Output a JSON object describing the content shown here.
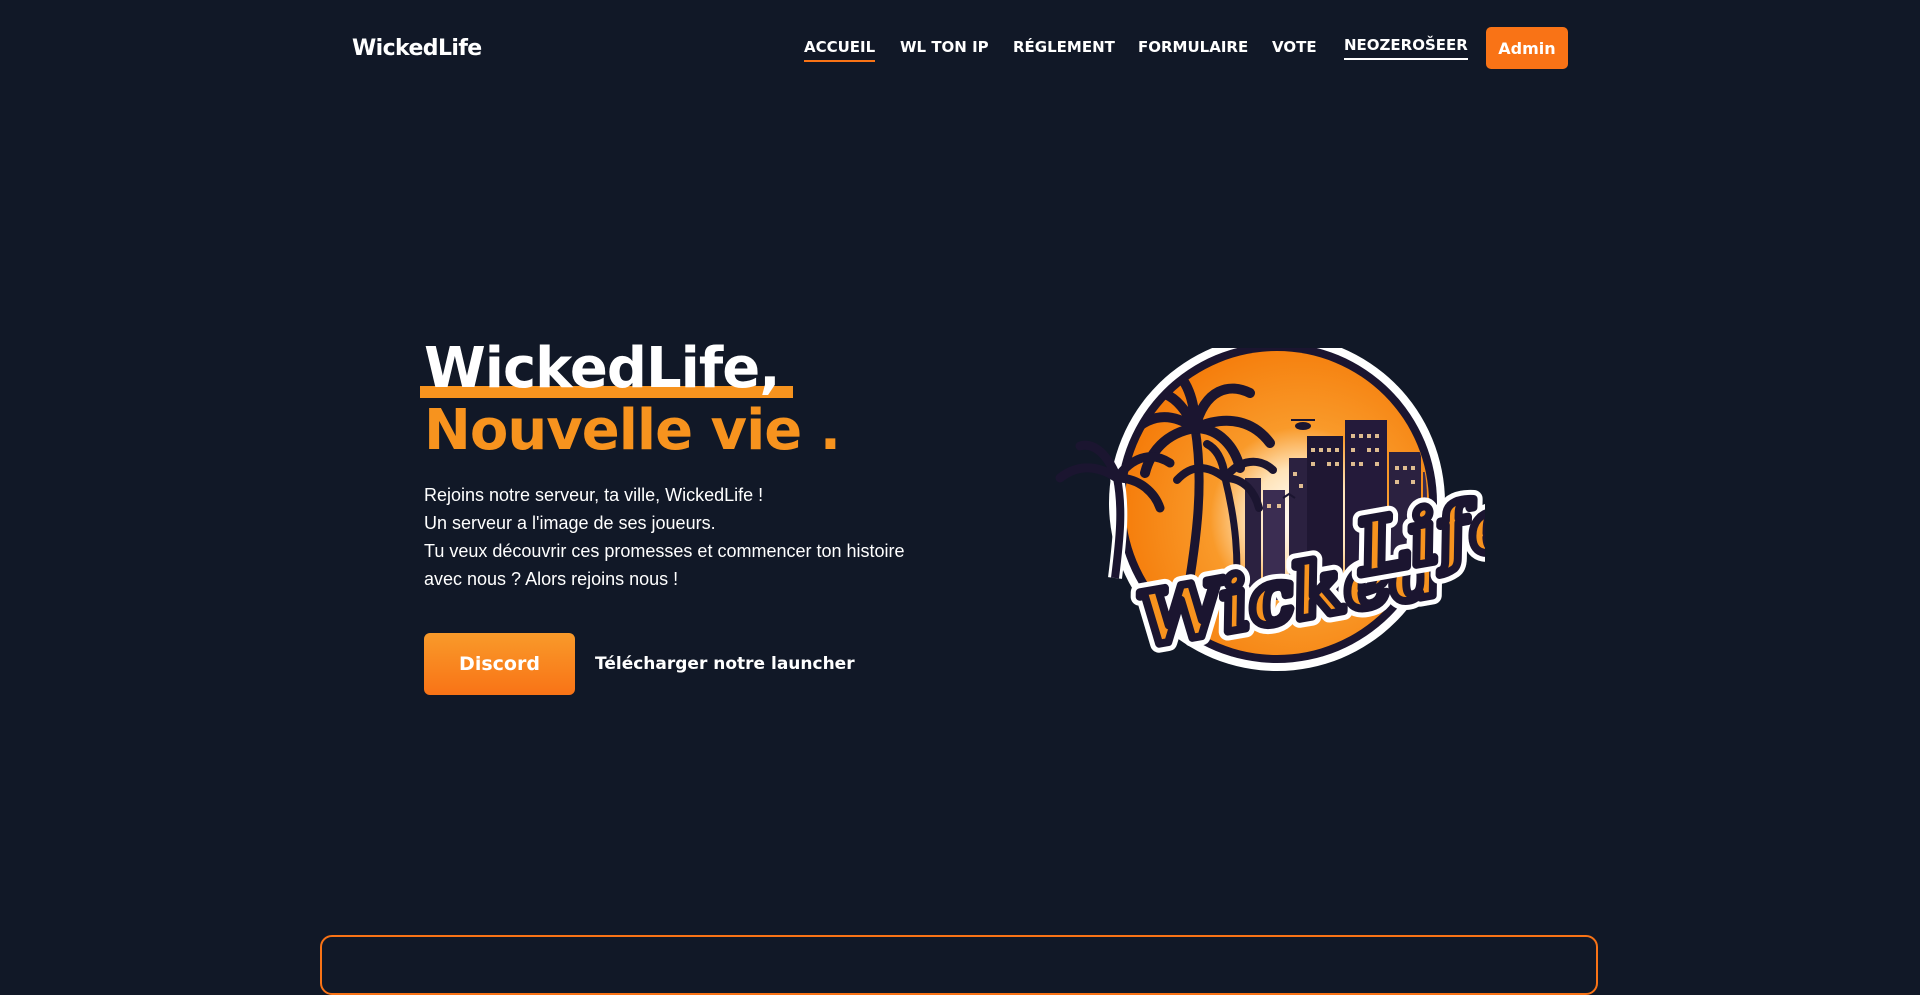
{
  "header": {
    "brand": "WickedLife",
    "nav": [
      {
        "label": "ACCUEIL"
      },
      {
        "label": "WL TON IP"
      },
      {
        "label": "RÉGLEMENT"
      },
      {
        "label": "FORMULAIRE"
      },
      {
        "label": "VOTE"
      },
      {
        "label": "NEOZEROŠEER"
      }
    ],
    "admin_label": "Admin"
  },
  "hero": {
    "title_line1": "WickedLife,",
    "title_line2": "Nouvelle vie .",
    "paragraph": [
      "Rejoins notre serveur, ta ville, WickedLife !",
      "Un serveur a l'image de ses joueurs.",
      "Tu veux découvrir ces promesses et commencer ton histoire",
      "avec nous ? Alors rejoins nous !"
    ],
    "discord_label": "Discord",
    "launcher_label": "Télécharger notre launcher"
  },
  "logo": {
    "text_part1": "Wicked",
    "text_part2": "Life"
  },
  "colors": {
    "background": "#111827",
    "accent": "#f97316",
    "accent_light": "#f7931e",
    "text": "#ffffff"
  },
  "icons": {
    "logo": "wickedlife-palm-city-logo"
  }
}
